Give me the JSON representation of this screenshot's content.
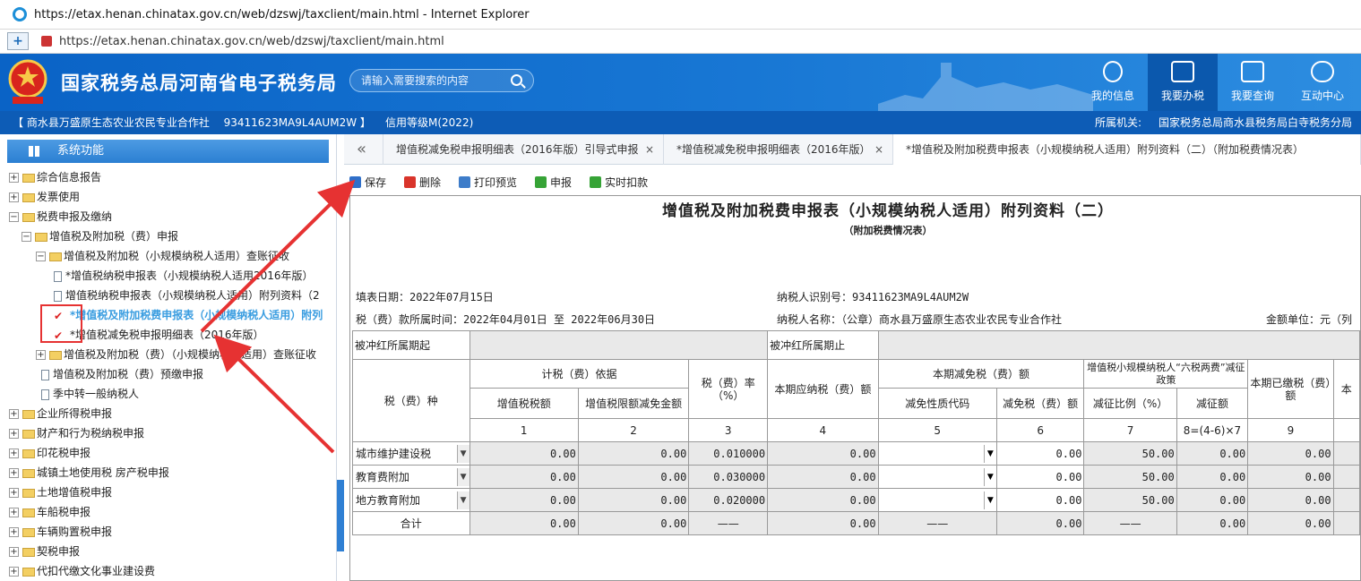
{
  "window": {
    "title": "https://etax.henan.chinatax.gov.cn/web/dzswj/taxclient/main.html - Internet Explorer"
  },
  "address": {
    "url": "https://etax.henan.chinatax.gov.cn/web/dzswj/taxclient/main.html"
  },
  "header": {
    "site_name": "国家税务总局河南省电子税务局",
    "search_placeholder": "请输入需要搜索的内容",
    "nav": [
      {
        "label": "我的信息",
        "icon": "user-icon"
      },
      {
        "label": "我要办税",
        "icon": "monitor-icon"
      },
      {
        "label": "我要查询",
        "icon": "document-search-icon"
      },
      {
        "label": "互动中心",
        "icon": "chat-icon"
      }
    ]
  },
  "infobar": {
    "company": "【 商水县万盛原生态农业农民专业合作社　 93411623MA9L4AUM2W 】",
    "credit": "信用等级M(2022)",
    "authority_label": "所属机关:",
    "authority": "国家税务总局商水县税务局白寺税务分局"
  },
  "sidebar": {
    "title": "系统功能",
    "items": [
      {
        "label": "综合信息报告",
        "expander": "+",
        "icon": "folder"
      },
      {
        "label": "发票使用",
        "expander": "+",
        "icon": "folder"
      },
      {
        "label": "税费申报及缴纳",
        "expander": "−",
        "icon": "folder"
      },
      {
        "label": "增值税及附加税（费）申报",
        "expander": "−",
        "icon": "folder"
      },
      {
        "label": "增值税及附加税（小规模纳税人适用）查账征收",
        "expander": "−",
        "icon": "folder"
      },
      {
        "label": "*增值税纳税申报表（小规模纳税人适用2016年版）",
        "expander": "",
        "icon": "doc"
      },
      {
        "label": "增值税纳税申报表（小规模纳税人适用）附列资料（2",
        "expander": "",
        "icon": "doc"
      },
      {
        "label": "*增值税及附加税费申报表（小规模纳税人适用）附列",
        "expander": "",
        "icon": "check"
      },
      {
        "label": "*增值税减免税申报明细表（2016年版）",
        "expander": "",
        "icon": "check"
      },
      {
        "label": "增值税及附加税（费）（小规模纳税人适用）查账征收",
        "expander": "+",
        "icon": "folder"
      },
      {
        "label": "增值税及附加税（费）预缴申报",
        "expander": "",
        "icon": "doc"
      },
      {
        "label": "季中转一般纳税人",
        "expander": "",
        "icon": "doc"
      },
      {
        "label": "企业所得税申报",
        "expander": "+",
        "icon": "folder"
      },
      {
        "label": "财产和行为税纳税申报",
        "expander": "+",
        "icon": "folder"
      },
      {
        "label": "印花税申报",
        "expander": "+",
        "icon": "folder"
      },
      {
        "label": "城镇土地使用税 房产税申报",
        "expander": "+",
        "icon": "folder"
      },
      {
        "label": "土地增值税申报",
        "expander": "+",
        "icon": "folder"
      },
      {
        "label": "车船税申报",
        "expander": "+",
        "icon": "folder"
      },
      {
        "label": "车辆购置税申报",
        "expander": "+",
        "icon": "folder"
      },
      {
        "label": "契税申报",
        "expander": "+",
        "icon": "folder"
      },
      {
        "label": "代扣代缴文化事业建设费",
        "expander": "+",
        "icon": "folder"
      }
    ]
  },
  "tabs": [
    {
      "label": "«"
    },
    {
      "label": "增值税减免税申报明细表（2016年版）引导式申报",
      "close": "×"
    },
    {
      "label": "*增值税减免税申报明细表（2016年版）",
      "close": "×"
    },
    {
      "label": "*增值税及附加税费申报表（小规模纳税人适用）附列资料（二）（附加税费情况表）"
    }
  ],
  "toolbar": {
    "save": "保存",
    "delete": "删除",
    "print": "打印预览",
    "declare": "申报",
    "deduct": "实时扣款"
  },
  "form": {
    "title": "增值税及附加税费申报表（小规模纳税人适用）附列资料（二）",
    "subtitle": "（附加税费情况表）",
    "fill_date": "填表日期：2022年07月15日",
    "tax_id": "纳税人识别号：93411623MA9L4AUM2W",
    "period": "税（费）款所属时间：2022年04月01日 至 2022年06月30日",
    "taxpayer": "纳税人名称：（公章）商水县万盛原生态农业农民专业合作社",
    "unit": "金额单位：元（列",
    "offset_start": "被冲红所属期起",
    "offset_end": "被冲红所属期止",
    "headers": {
      "tax_type": "税（费）种",
      "basis": "计税（费）依据",
      "vat_amount": "增值税税额",
      "vat_credit": "增值税限额减免金额",
      "rate": "税（费）率（%）",
      "payable": "本期应纳税（费）额",
      "reduction": "本期减免税（费）额",
      "reduction_code": "减免性质代码",
      "reduction_amount": "减免税（费）额",
      "six_policy": "增值税小规模纳税人“六税两费”减征政策",
      "reduction_ratio": "减征比例（%）",
      "reduction_value": "减征额",
      "paid": "本期已缴税（费）额",
      "next": "本"
    },
    "col_numbers": [
      "1",
      "2",
      "3",
      "4",
      "5",
      "6",
      "7",
      "8=(4-6)×7",
      "9"
    ],
    "rows": [
      {
        "name": "城市维护建设税",
        "c1": "0.00",
        "c2": "0.00",
        "c3": "0.010000",
        "c4": "0.00",
        "c5": "",
        "c6": "0.00",
        "c7": "50.00",
        "c8": "0.00",
        "c9": "0.00"
      },
      {
        "name": "教育费附加",
        "c1": "0.00",
        "c2": "0.00",
        "c3": "0.030000",
        "c4": "0.00",
        "c5": "",
        "c6": "0.00",
        "c7": "50.00",
        "c8": "0.00",
        "c9": "0.00"
      },
      {
        "name": "地方教育附加",
        "c1": "0.00",
        "c2": "0.00",
        "c3": "0.020000",
        "c4": "0.00",
        "c5": "",
        "c6": "0.00",
        "c7": "50.00",
        "c8": "0.00",
        "c9": "0.00"
      }
    ],
    "total": {
      "name": "合计",
      "c1": "0.00",
      "c2": "0.00",
      "c3": "——",
      "c4": "0.00",
      "c5": "——",
      "c6": "0.00",
      "c7": "——",
      "c8": "0.00",
      "c9": "0.00"
    }
  },
  "colors": {
    "brand_blue": "#0a63c6",
    "info_bar": "#0d5cb6",
    "annotation_red": "#e63232",
    "selected_item": "#3a9de0"
  }
}
